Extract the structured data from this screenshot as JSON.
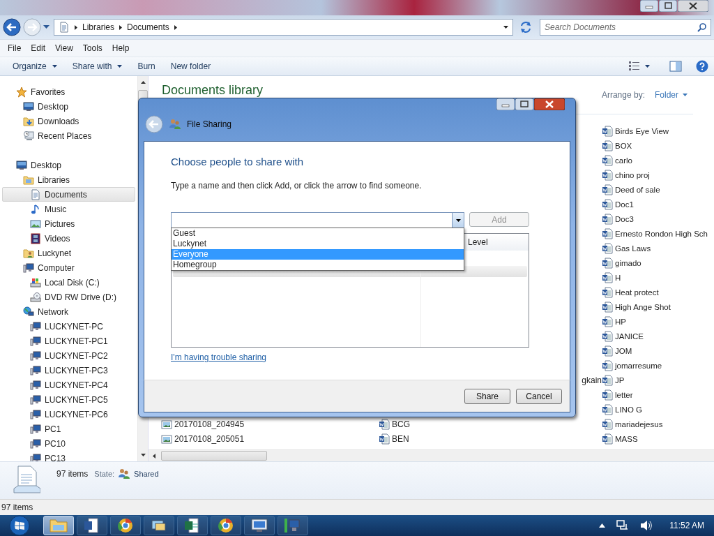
{
  "explorer": {
    "address": {
      "segments": [
        "Libraries",
        "Documents"
      ]
    },
    "search": {
      "placeholder": "Search Documents"
    },
    "menu": [
      "File",
      "Edit",
      "View",
      "Tools",
      "Help"
    ],
    "toolbar": [
      {
        "label": "Organize",
        "dropdown": true
      },
      {
        "label": "Share with",
        "dropdown": true
      },
      {
        "label": "Burn",
        "dropdown": false
      },
      {
        "label": "New folder",
        "dropdown": false
      }
    ],
    "nav": [
      {
        "label": "Favorites",
        "kind": "favorites",
        "selected": false,
        "children": [
          {
            "label": "Desktop",
            "kind": "desktop",
            "selected": false
          },
          {
            "label": "Downloads",
            "kind": "downloads",
            "selected": false
          },
          {
            "label": "Recent Places",
            "kind": "recent",
            "selected": false
          }
        ]
      },
      {
        "label": "Desktop",
        "kind": "desktop",
        "selected": false,
        "children": [
          {
            "label": "Libraries",
            "kind": "libraries",
            "selected": false,
            "children": [
              {
                "label": "Documents",
                "kind": "documents",
                "selected": true
              },
              {
                "label": "Music",
                "kind": "music",
                "selected": false
              },
              {
                "label": "Pictures",
                "kind": "pictures",
                "selected": false
              },
              {
                "label": "Videos",
                "kind": "videos",
                "selected": false
              }
            ]
          },
          {
            "label": "Luckynet",
            "kind": "user",
            "selected": false
          },
          {
            "label": "Computer",
            "kind": "computer",
            "selected": false,
            "children": [
              {
                "label": "Local Disk (C:)",
                "kind": "disk",
                "selected": false
              },
              {
                "label": "DVD RW Drive (D:)",
                "kind": "dvd",
                "selected": false
              }
            ]
          },
          {
            "label": "Network",
            "kind": "network",
            "selected": false,
            "children": [
              {
                "label": "LUCKYNET-PC",
                "kind": "pc",
                "selected": false
              },
              {
                "label": "LUCKYNET-PC1",
                "kind": "pc",
                "selected": false
              },
              {
                "label": "LUCKYNET-PC2",
                "kind": "pc",
                "selected": false
              },
              {
                "label": "LUCKYNET-PC3",
                "kind": "pc",
                "selected": false
              },
              {
                "label": "LUCKYNET-PC4",
                "kind": "pc",
                "selected": false
              },
              {
                "label": "LUCKYNET-PC5",
                "kind": "pc",
                "selected": false
              },
              {
                "label": "LUCKYNET-PC6",
                "kind": "pc",
                "selected": false
              },
              {
                "label": "PC1",
                "kind": "pc",
                "selected": false
              },
              {
                "label": "PC10",
                "kind": "pc",
                "selected": false
              },
              {
                "label": "PC13",
                "kind": "pc",
                "selected": false
              }
            ]
          }
        ]
      }
    ],
    "library": {
      "title": "Documents library",
      "arrange_label": "Arrange by:",
      "arrange_value": "Folder"
    },
    "files": {
      "column_1": [
        {
          "name": "20170108_204945",
          "kind": "image"
        },
        {
          "name": "20170108_205051",
          "kind": "image"
        }
      ],
      "column_2": [
        {
          "name": "gkain",
          "kind": "fragment"
        },
        {
          "name": "BCG",
          "kind": "word"
        },
        {
          "name": "BEN",
          "kind": "word"
        }
      ],
      "column_3": [
        {
          "name": "Birds Eye View",
          "kind": "word"
        },
        {
          "name": "BOX",
          "kind": "word"
        },
        {
          "name": "carlo",
          "kind": "word"
        },
        {
          "name": "chino proj",
          "kind": "word"
        },
        {
          "name": "Deed of sale",
          "kind": "word"
        },
        {
          "name": "Doc1",
          "kind": "word"
        },
        {
          "name": "Doc3",
          "kind": "word"
        },
        {
          "name": "Ernesto Rondon High Sch",
          "kind": "word"
        },
        {
          "name": "Gas Laws",
          "kind": "word"
        },
        {
          "name": "gimado",
          "kind": "word"
        },
        {
          "name": "H",
          "kind": "word"
        },
        {
          "name": "Heat protect",
          "kind": "word"
        },
        {
          "name": "High Ange Shot",
          "kind": "word"
        },
        {
          "name": "HP",
          "kind": "word"
        },
        {
          "name": "JANICE",
          "kind": "word"
        },
        {
          "name": "JOM",
          "kind": "word"
        },
        {
          "name": "jomarresume",
          "kind": "word"
        },
        {
          "name": "JP",
          "kind": "word"
        },
        {
          "name": "letter",
          "kind": "word"
        },
        {
          "name": "LINO G",
          "kind": "word"
        },
        {
          "name": "mariadejesus",
          "kind": "word"
        },
        {
          "name": "MASS",
          "kind": "word"
        }
      ]
    },
    "details": {
      "count": "97 items",
      "state_label": "State:",
      "state": "Shared"
    },
    "status_bar": "97 items"
  },
  "dialog": {
    "title": "File Sharing",
    "heading": "Choose people to share with",
    "instruction": "Type a name and then click Add, or click the arrow to find someone.",
    "combo": {
      "expanded": true,
      "options": [
        {
          "label": "Guest",
          "selected": false
        },
        {
          "label": "Luckynet",
          "selected": false
        },
        {
          "label": "Everyone",
          "selected": true
        },
        {
          "label": "Homegroup",
          "selected": false
        }
      ]
    },
    "add_button": {
      "label": "Add",
      "disabled": true
    },
    "table": {
      "column_2": "Level"
    },
    "link": "I'm having trouble sharing",
    "buttons": [
      "Share",
      "Cancel"
    ]
  },
  "taskbar": {
    "apps": [
      {
        "kind": "folder",
        "selected": true
      },
      {
        "kind": "doc",
        "selected": false
      },
      {
        "kind": "globe",
        "selected": false
      },
      {
        "kind": "pictures",
        "selected": false
      },
      {
        "kind": "sheet",
        "selected": false
      },
      {
        "kind": "globe",
        "selected": false
      },
      {
        "kind": "screen",
        "selected": false
      },
      {
        "kind": "network",
        "selected": false
      }
    ],
    "clock": "11:52 AM"
  }
}
